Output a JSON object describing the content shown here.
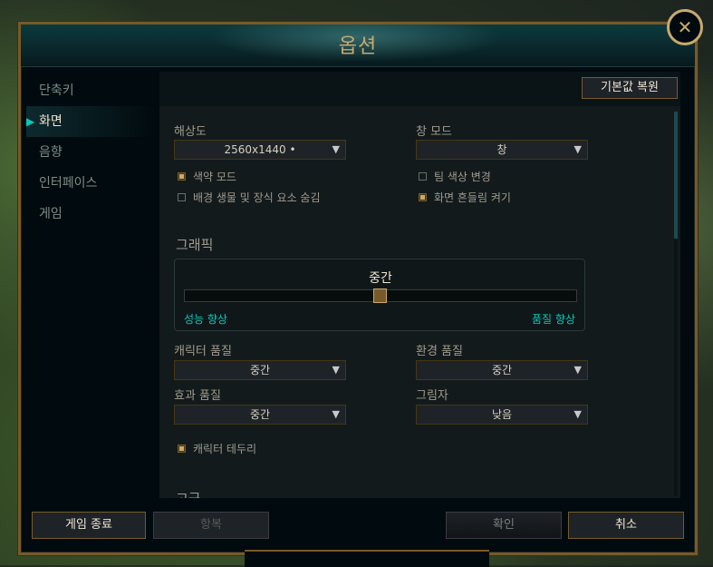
{
  "window": {
    "title": "옵션",
    "close_icon": "close-icon"
  },
  "nav": {
    "items": [
      {
        "label": "단축키",
        "active": false
      },
      {
        "label": "화면",
        "active": true
      },
      {
        "label": "음향",
        "active": false
      },
      {
        "label": "인터페이스",
        "active": false
      },
      {
        "label": "게임",
        "active": false
      }
    ]
  },
  "content": {
    "reset_button": "기본값 복원",
    "resolution": {
      "label": "해상도",
      "value": "2560x1440 •"
    },
    "window_mode": {
      "label": "창 모드",
      "value": "창"
    },
    "checks": {
      "colorblind": {
        "label": "색약 모드",
        "checked": true
      },
      "hide_eye_candy": {
        "label": "배경 생물 및 장식 요소 숨김",
        "checked": false
      },
      "team_color": {
        "label": "팀 색상 변경",
        "checked": false
      },
      "screen_shake": {
        "label": "화면 흔들림 켜기",
        "checked": true
      },
      "char_outline": {
        "label": "캐릭터 테두리",
        "checked": true
      }
    },
    "graphics": {
      "section_title": "그래픽",
      "level_label": "중간",
      "left_label": "성능 향상",
      "right_label": "품질 향상",
      "level_fraction": 0.5
    },
    "character_quality": {
      "label": "캐릭터 품질",
      "value": "중간"
    },
    "environment_quality": {
      "label": "환경 품질",
      "value": "중간"
    },
    "effects_quality": {
      "label": "효과 품질",
      "value": "중간"
    },
    "shadows": {
      "label": "그림자",
      "value": "낮음"
    },
    "next_section_partial": "고급"
  },
  "footer": {
    "exit_game": "게임 종료",
    "surrender": "항복",
    "ok": "확인",
    "cancel": "취소"
  },
  "colors": {
    "gold": "#c8aa6e",
    "teal": "#0ac8b9",
    "background": "#010a0e"
  }
}
